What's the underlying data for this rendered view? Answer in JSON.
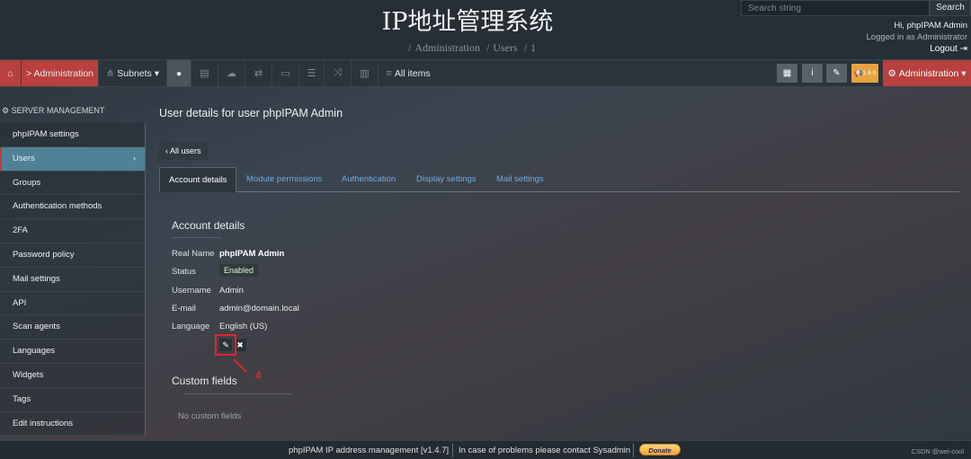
{
  "header": {
    "site_title": "IP地址管理系统",
    "breadcrumb": [
      "Administration",
      "Users",
      "1"
    ],
    "search": {
      "placeholder": "Search string",
      "button_label": "Search"
    },
    "user": {
      "greeting": "Hi, phpIPAM Admin",
      "role": "Logged in as  Administrator",
      "logout_label": "Logout"
    }
  },
  "navbar": {
    "home_icon": "home-icon",
    "admin_crumb": "> Administration",
    "subnets_label": "Subnets",
    "all_items_label": "All items",
    "badge_text": "1 6 0",
    "admin_menu_label": "Administration",
    "icons": [
      "user-icon",
      "table-icon",
      "cloud-icon",
      "exchange-icon",
      "desktop-icon",
      "list-icon",
      "random-icon",
      "map-icon"
    ],
    "right_icons": [
      "grid-icon",
      "info-icon",
      "wrench-icon",
      "bullhorn-icon"
    ]
  },
  "sidebar": {
    "title": "SERVER MANAGEMENT",
    "items": [
      {
        "label": "phpIPAM settings"
      },
      {
        "label": "Users",
        "active": true
      },
      {
        "label": "Groups"
      },
      {
        "label": "Authentication methods"
      },
      {
        "label": "2FA"
      },
      {
        "label": "Password policy"
      },
      {
        "label": "Mail settings"
      },
      {
        "label": "API"
      },
      {
        "label": "Scan agents"
      },
      {
        "label": "Languages"
      },
      {
        "label": "Widgets"
      },
      {
        "label": "Tags"
      },
      {
        "label": "Edit instructions"
      }
    ]
  },
  "main": {
    "page_title": "User details for user phpIPAM Admin",
    "back_label": "‹ All users",
    "tabs": [
      {
        "label": "Account details",
        "active": true
      },
      {
        "label": "Module permissions"
      },
      {
        "label": "Authentication"
      },
      {
        "label": "Display settings"
      },
      {
        "label": "Mail settings"
      }
    ],
    "account_section_title": "Account details",
    "details": [
      {
        "label": "Real Name",
        "value": "phpIPAM Admin"
      },
      {
        "label": "Status",
        "value": "Enabled"
      },
      {
        "label": "Username",
        "value": "Admin"
      },
      {
        "label": "E-mail",
        "value": "admin@domain.local"
      },
      {
        "label": "Language",
        "value": "English (US)"
      }
    ],
    "annotation_number": "4",
    "custom_section_title": "Custom fields",
    "custom_empty": "No custom fields"
  },
  "footer": {
    "version": "phpIPAM IP address management [v1.4.7]",
    "contact": "In case of problems please contact Sysadmin",
    "donate_label": "Donate",
    "watermark": "CSDN @wei-cool"
  }
}
